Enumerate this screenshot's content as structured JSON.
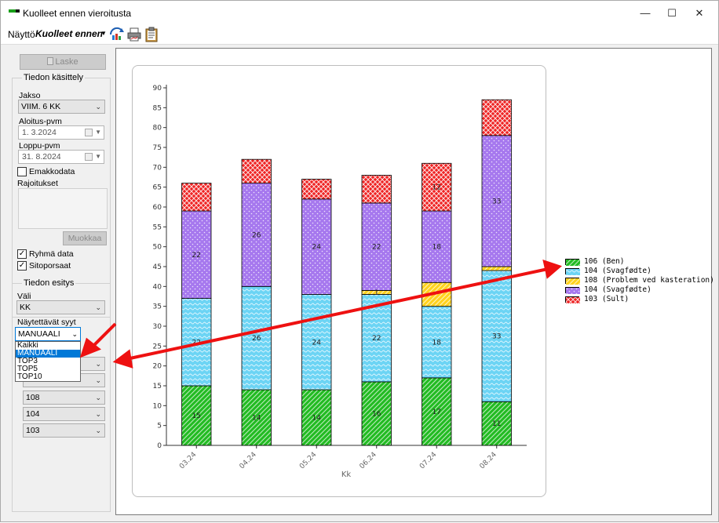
{
  "window": {
    "title": "Kuolleet ennen vieroitusta",
    "minimize_icon": "minimize-icon",
    "maximize_icon": "maximize-icon",
    "close_icon": "close-icon"
  },
  "menubar": {
    "view_label": "Näyttö",
    "view_value": "Kuolleet ennen vieroitusta"
  },
  "toolbar": {
    "icons": [
      "refresh-chart-icon",
      "print-icon",
      "clipboard-icon"
    ]
  },
  "left": {
    "laske_label": "Laske",
    "data_group_label": "Tiedon käsittely",
    "jakso_label": "Jakso",
    "jakso_value": "VIIM. 6 KK",
    "start_label": "Aloitus-pvm",
    "start_value": "1.  3.2024",
    "end_label": "Loppu-pvm",
    "end_value": "31.  8.2024",
    "emakkodata_label": "Emakkodata",
    "emakkodata_checked": false,
    "rajoitukset_label": "Rajoitukset",
    "muokkaa_label": "Muokkaa",
    "ryhma_label": "Ryhmä data",
    "ryhma_checked": true,
    "sitoporsaat_label": "Sitoporsaat",
    "sitoporsaat_checked": true,
    "display_group_label": "Tiedon esitys",
    "vali_label": "Väli",
    "vali_value": "KK",
    "syyt_label": "Näytettävät syyt",
    "syyt_value": "MANUAALI",
    "syyt_options": [
      "Kaikki",
      "MANUAALI",
      "TOP3",
      "TOP5",
      "TOP10"
    ],
    "syyt_selected_index": 1,
    "cause_combos": [
      "",
      "",
      "108",
      "104",
      "103"
    ]
  },
  "chart_data": {
    "type": "bar",
    "stacked": true,
    "categories": [
      "03.24",
      "04.24",
      "05.24",
      "06.24",
      "07.24",
      "08.24"
    ],
    "xlabel": "Kk",
    "ylabel": "",
    "ylim": [
      0,
      90
    ],
    "yticks": [
      0,
      5,
      10,
      15,
      20,
      25,
      30,
      35,
      40,
      45,
      50,
      55,
      60,
      65,
      70,
      75,
      80,
      85,
      90
    ],
    "grid": false,
    "legend_position": "right",
    "series": [
      {
        "name": "106 (Ben)",
        "color": "#22bb22",
        "values": [
          15,
          14,
          14,
          16,
          17,
          11
        ],
        "labels": [
          "15",
          "14",
          "14",
          "16",
          "17",
          "11"
        ]
      },
      {
        "name": "104 (Svagfødte)",
        "color": "#6cd4f4",
        "values": [
          22,
          26,
          24,
          22,
          18,
          33
        ],
        "labels": [
          "22",
          "26",
          "24",
          "22",
          "18",
          "33"
        ]
      },
      {
        "name": "108 (Problem ved kasteration)",
        "color": "#ffd21e",
        "values": [
          0,
          0,
          0,
          1,
          6,
          1
        ],
        "labels": [
          "",
          "",
          "",
          "1",
          "",
          ""
        ]
      },
      {
        "name": "104 (Svagfødte)",
        "color": "#a678ee",
        "values": [
          22,
          26,
          24,
          22,
          18,
          33
        ],
        "labels": [
          "22",
          "26",
          "24",
          "22",
          "18",
          "33"
        ]
      },
      {
        "name": "103 (Sult)",
        "color": "#ee2222",
        "values": [
          7,
          6,
          5,
          7,
          12,
          9
        ],
        "labels": [
          "",
          "",
          "",
          "",
          "12",
          ""
        ]
      }
    ]
  },
  "annotation": {
    "arrow_color": "#ee1111"
  }
}
